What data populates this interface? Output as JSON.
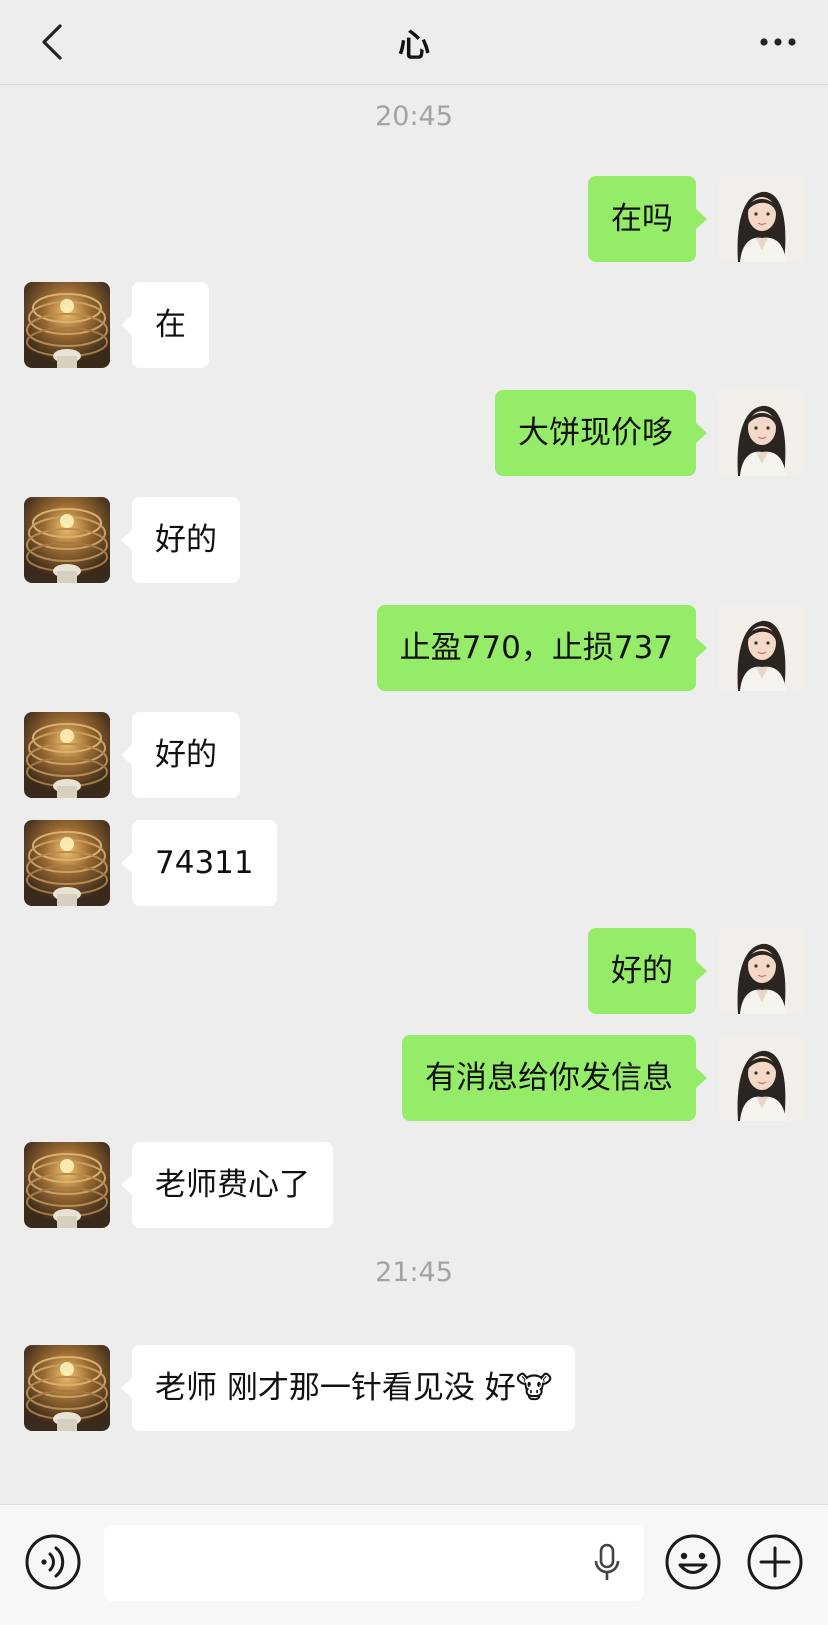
{
  "header": {
    "title": "心"
  },
  "messages": [
    {
      "type": "time",
      "text": "20:45"
    },
    {
      "type": "msg",
      "dir": "out",
      "text": "在吗"
    },
    {
      "type": "msg",
      "dir": "in",
      "text": "在"
    },
    {
      "type": "msg",
      "dir": "out",
      "text": "大饼现价哆"
    },
    {
      "type": "msg",
      "dir": "in",
      "text": "好的"
    },
    {
      "type": "msg",
      "dir": "out",
      "text": "止盈770，止损737"
    },
    {
      "type": "msg",
      "dir": "in",
      "text": "好的"
    },
    {
      "type": "msg",
      "dir": "in",
      "text": "74311"
    },
    {
      "type": "msg",
      "dir": "out",
      "text": "好的"
    },
    {
      "type": "msg",
      "dir": "out",
      "text": "有消息给你发信息"
    },
    {
      "type": "msg",
      "dir": "in",
      "text": "老师费心了"
    },
    {
      "type": "time",
      "text": "21:45"
    },
    {
      "type": "msg",
      "dir": "in",
      "text": "老师 刚才那一针看见没 好🐮"
    }
  ],
  "icons": {
    "back": "chevron-left-icon",
    "more": "more-dots-icon",
    "voice": "voice-icon",
    "mic": "microphone-icon",
    "emoji": "emoji-icon",
    "plus": "plus-icon"
  },
  "colors": {
    "background": "#ededed",
    "outgoing_bubble": "#95ec69",
    "incoming_bubble": "#ffffff",
    "timestamp": "#a3a3a3"
  }
}
